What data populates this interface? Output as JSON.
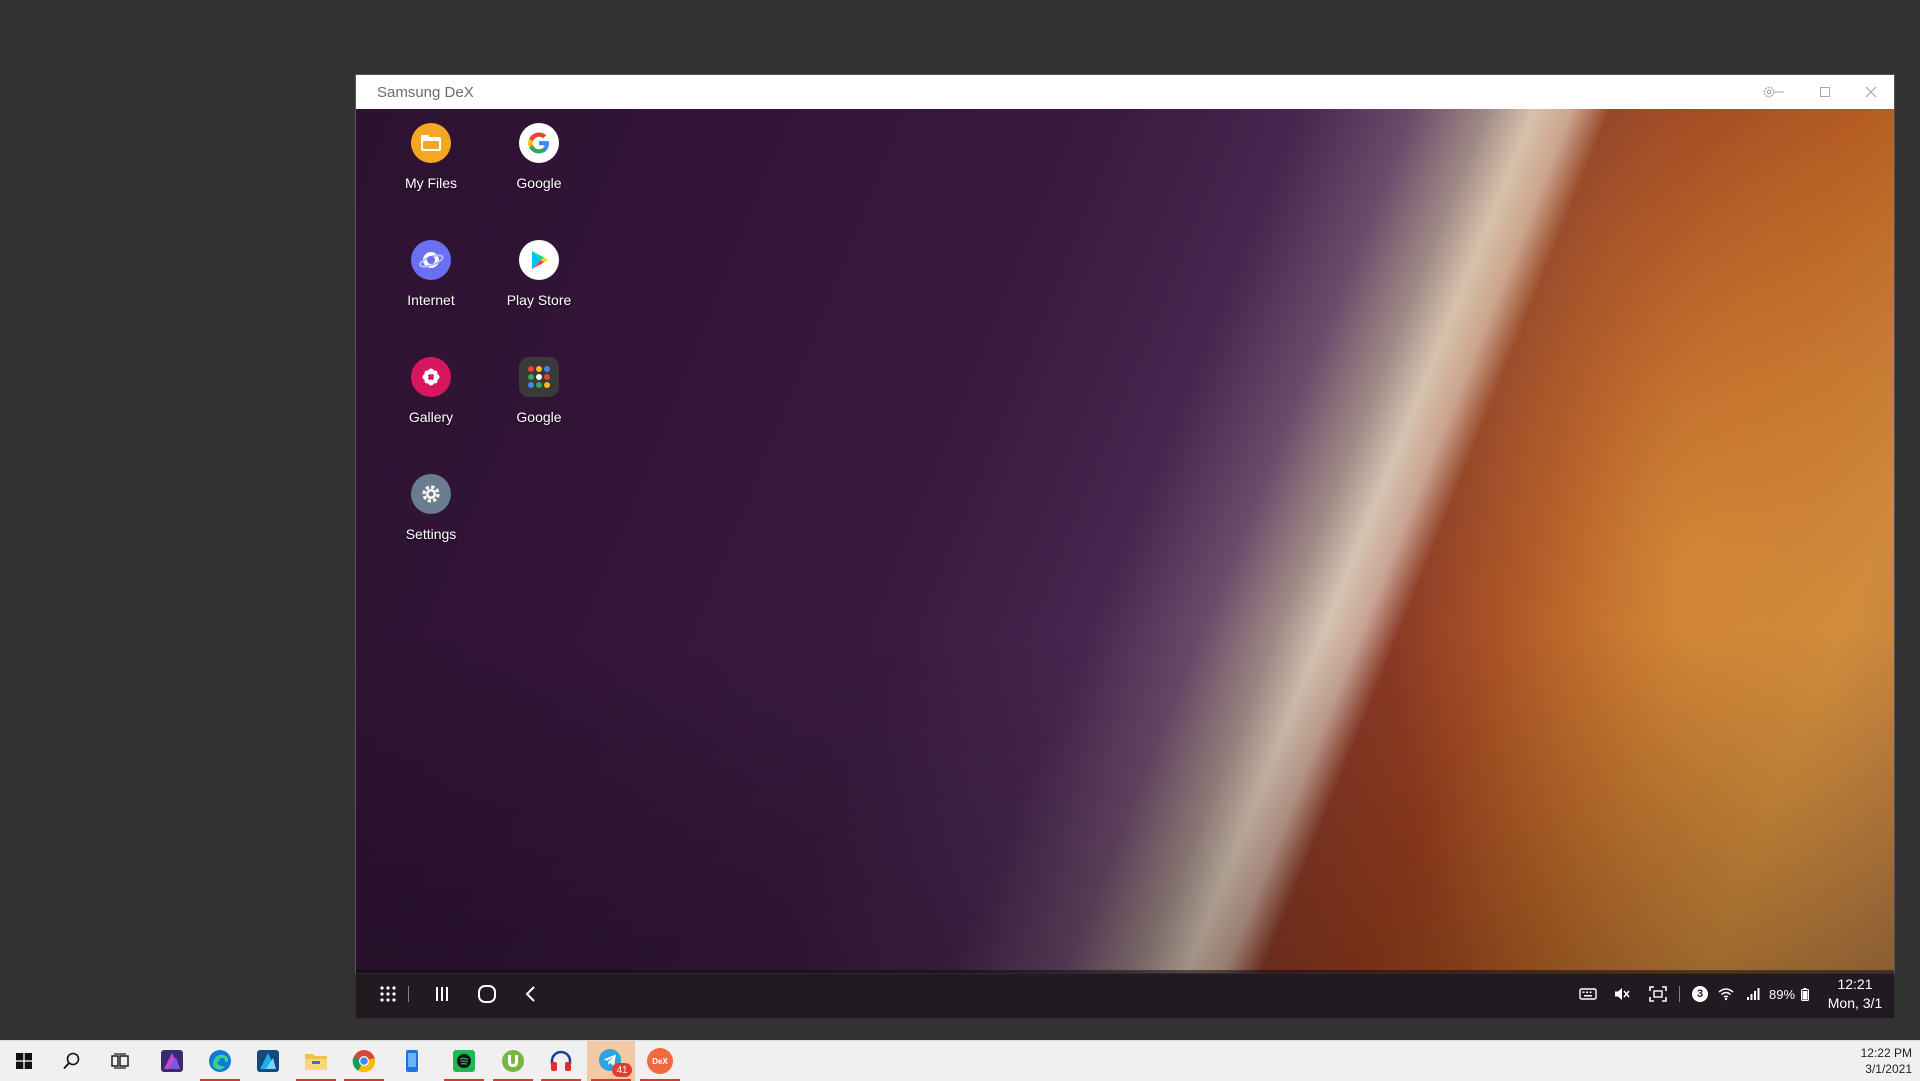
{
  "window": {
    "title": "Samsung DeX",
    "controls": {
      "settings": "gear-icon",
      "minimize": "minimize-icon",
      "maximize": "maximize-icon",
      "close": "close-icon"
    }
  },
  "desktop_apps": [
    {
      "label": "My Files",
      "icon": "folder-icon",
      "color": "#f5a623"
    },
    {
      "label": "Google",
      "icon": "google-g-icon",
      "color": "#ffffff"
    },
    {
      "label": "Internet",
      "icon": "browser-planet-icon",
      "color": "#6b6ff2"
    },
    {
      "label": "Play Store",
      "icon": "play-store-icon",
      "color": "#ffffff"
    },
    {
      "label": "Gallery",
      "icon": "flower-icon",
      "color": "#d6175f"
    },
    {
      "label": "Google",
      "icon": "app-folder-icon",
      "color": "#3a3a3a"
    },
    {
      "label": "Settings",
      "icon": "gear-icon",
      "color": "#6a7d90"
    }
  ],
  "dex_taskbar": {
    "nav": [
      "apps-grid-icon",
      "recents-icon",
      "home-icon",
      "back-icon"
    ],
    "tray": {
      "notification_count": "3",
      "battery": "89%",
      "time": "12:21",
      "date": "Mon, 3/1"
    }
  },
  "win_taskbar": {
    "apps": [
      "windows-start-icon",
      "search-icon",
      "task-view-icon",
      "affinity-photo-icon",
      "edge-icon",
      "affinity-designer-icon",
      "file-explorer-icon",
      "chrome-icon",
      "phone-icon",
      "spotify-icon",
      "utorrent-icon",
      "headphones-app-icon",
      "telegram-icon",
      "samsung-dex-icon"
    ],
    "telegram_badge": "41",
    "dex_icon_text": "DeX",
    "time": "12:22 PM",
    "date": "3/1/2021"
  },
  "colors": {
    "accent_running": "#d43a2f",
    "dex_orange": "#f06a3d"
  }
}
